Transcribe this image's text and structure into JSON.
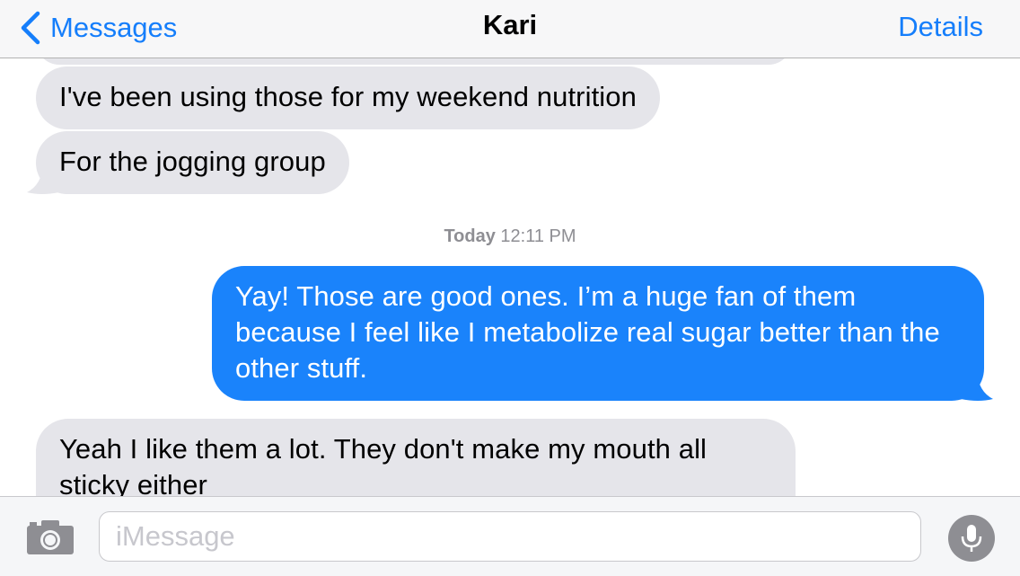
{
  "nav": {
    "back_label": "Messages",
    "title": "Kari",
    "details_label": "Details"
  },
  "messages": [
    {
      "direction": "incoming",
      "text": "I've been using those for my weekend nutrition"
    },
    {
      "direction": "incoming",
      "text": "For the jogging group"
    },
    {
      "direction": "outgoing",
      "text": "Yay! Those are good ones. I’m a huge fan of them because I feel like I metabolize real sugar better than the other stuff."
    },
    {
      "direction": "incoming",
      "text": "Yeah I like them a lot. They don't make my mouth all sticky either"
    }
  ],
  "timestamp": {
    "day": "Today",
    "time": "12:11 PM"
  },
  "composer": {
    "placeholder": "iMessage",
    "camera_icon": "camera-icon",
    "mic_icon": "microphone-icon"
  },
  "colors": {
    "accent": "#157efb",
    "outgoing_bubble": "#1a83fb",
    "incoming_bubble": "#e5e5ea",
    "timestamp": "#8e8e93"
  }
}
